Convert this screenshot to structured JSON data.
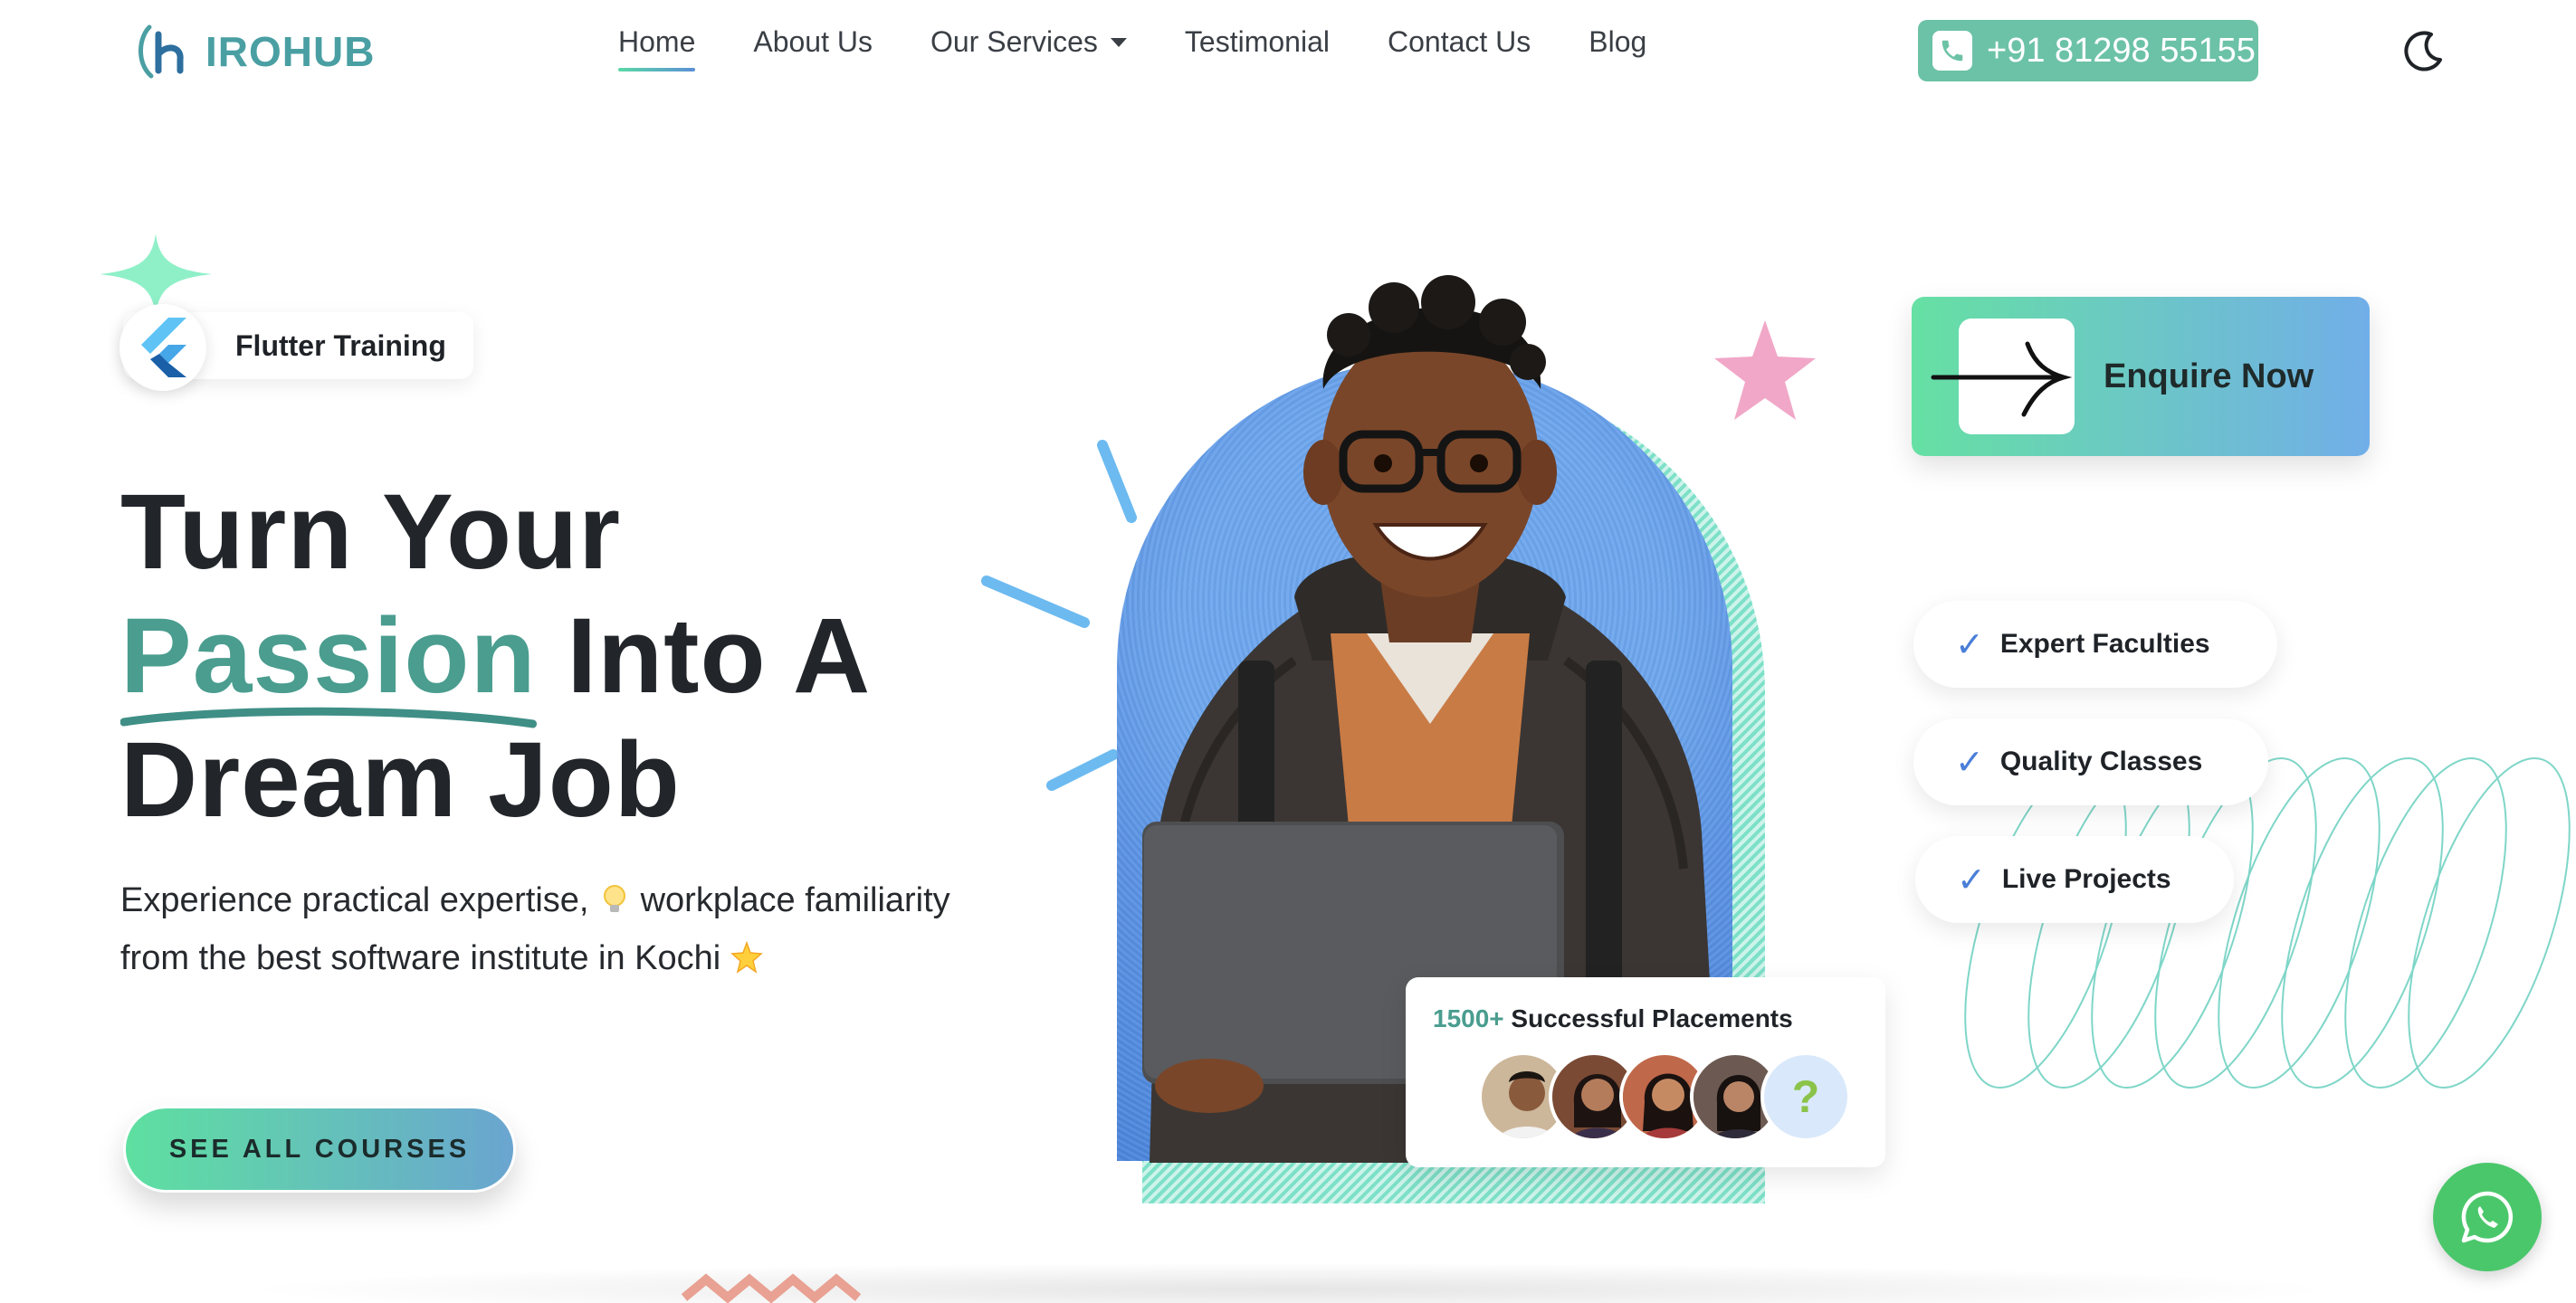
{
  "nav": {
    "logo_text": "IROHUB",
    "items": [
      {
        "label": "Home",
        "active": true
      },
      {
        "label": "About Us"
      },
      {
        "label": "Our Services",
        "dropdown": true
      },
      {
        "label": "Testimonial"
      },
      {
        "label": "Contact Us"
      },
      {
        "label": "Blog"
      }
    ],
    "phone": "+91 81298 55155"
  },
  "hero": {
    "badge": "Flutter Training",
    "title_line1": "Turn Your",
    "title_highlight": "Passion",
    "title_line2_rest": " Into A",
    "title_line3": "Dream Job",
    "subtitle_part1": "Experience practical expertise, ",
    "subtitle_part2": " workplace familiarity from the best software institute in Kochi ",
    "cta": "SEE ALL COURSES"
  },
  "enquire": {
    "label": "Enquire Now"
  },
  "features": [
    "Expert Faculties",
    "Quality Classes",
    "Live Projects"
  ],
  "placements": {
    "count": "1500+",
    "label": " Successful Placements",
    "more_symbol": "?"
  },
  "colors": {
    "accent_teal": "#4a9d8f",
    "gradient_start": "#5ee0a0",
    "gradient_end": "#6aa5d0",
    "arch_blue": "#5b93e4",
    "whatsapp_green": "#4bc76b"
  }
}
